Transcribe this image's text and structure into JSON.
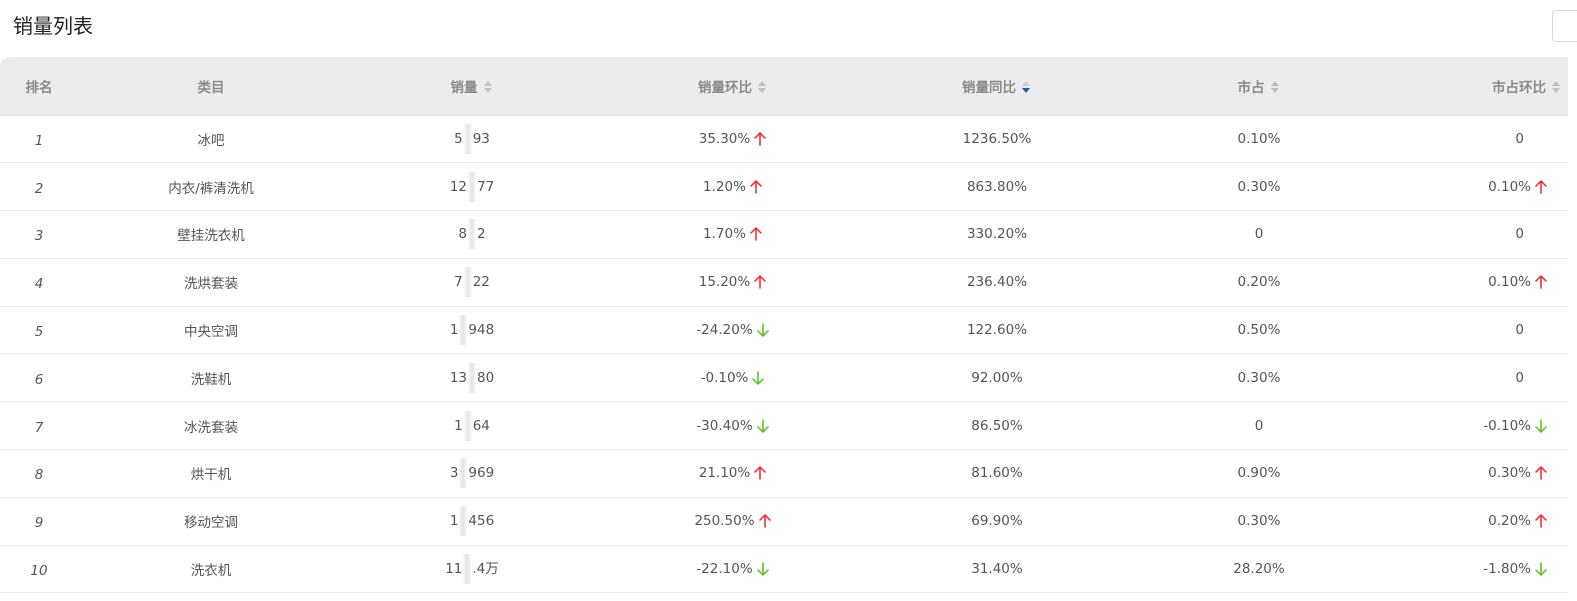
{
  "page": {
    "title": "销量列表"
  },
  "columns": [
    "排名",
    "类目",
    "销量",
    "销量环比",
    "销量同比",
    "市占",
    "市占环比"
  ],
  "colors": {
    "up": "#f5222d",
    "down": "#52c41a",
    "sort_active": "#1f5fbf"
  },
  "rows": [
    {
      "rank": "1",
      "category": "冰吧",
      "sales_a": "5",
      "sales_b": "93",
      "mom": "35.30%",
      "mom_dir": "up",
      "yoy": "1236.50%",
      "share": "0.10%",
      "share_mom": "0",
      "share_dir": ""
    },
    {
      "rank": "2",
      "category": "内衣/裤清洗机",
      "sales_a": "12",
      "sales_b": "77",
      "mom": "1.20%",
      "mom_dir": "up",
      "yoy": "863.80%",
      "share": "0.30%",
      "share_mom": "0.10%",
      "share_dir": "up"
    },
    {
      "rank": "3",
      "category": "壁挂洗衣机",
      "sales_a": "8",
      "sales_b": "2",
      "mom": "1.70%",
      "mom_dir": "up",
      "yoy": "330.20%",
      "share": "0",
      "share_mom": "0",
      "share_dir": ""
    },
    {
      "rank": "4",
      "category": "洗烘套装",
      "sales_a": "7",
      "sales_b": "22",
      "mom": "15.20%",
      "mom_dir": "up",
      "yoy": "236.40%",
      "share": "0.20%",
      "share_mom": "0.10%",
      "share_dir": "up"
    },
    {
      "rank": "5",
      "category": "中央空调",
      "sales_a": "1",
      "sales_b": "948",
      "mom": "-24.20%",
      "mom_dir": "down",
      "yoy": "122.60%",
      "share": "0.50%",
      "share_mom": "0",
      "share_dir": ""
    },
    {
      "rank": "6",
      "category": "洗鞋机",
      "sales_a": "13",
      "sales_b": "80",
      "mom": "-0.10%",
      "mom_dir": "down",
      "yoy": "92.00%",
      "share": "0.30%",
      "share_mom": "0",
      "share_dir": ""
    },
    {
      "rank": "7",
      "category": "冰洗套装",
      "sales_a": "1",
      "sales_b": "64",
      "mom": "-30.40%",
      "mom_dir": "down",
      "yoy": "86.50%",
      "share": "0",
      "share_mom": "-0.10%",
      "share_dir": "down"
    },
    {
      "rank": "8",
      "category": "烘干机",
      "sales_a": "3",
      "sales_b": "969",
      "mom": "21.10%",
      "mom_dir": "up",
      "yoy": "81.60%",
      "share": "0.90%",
      "share_mom": "0.30%",
      "share_dir": "up"
    },
    {
      "rank": "9",
      "category": "移动空调",
      "sales_a": "1",
      "sales_b": "456",
      "mom": "250.50%",
      "mom_dir": "up",
      "yoy": "69.90%",
      "share": "0.30%",
      "share_mom": "0.20%",
      "share_dir": "up"
    },
    {
      "rank": "10",
      "category": "洗衣机",
      "sales_a": "11",
      "sales_b": ".4万",
      "mom": "-22.10%",
      "mom_dir": "down",
      "yoy": "31.40%",
      "share": "28.20%",
      "share_mom": "-1.80%",
      "share_dir": "down"
    }
  ]
}
